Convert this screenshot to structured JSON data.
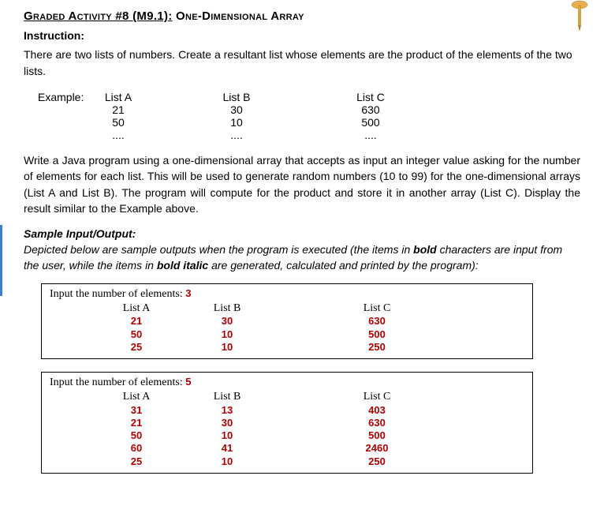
{
  "title": {
    "prefix": "Graded Activity #8 (M9.1):",
    "rest": " One-Dimensional Array"
  },
  "instruction_label": "Instruction:",
  "instruction_text": "There are two lists of numbers. Create a resultant list whose elements are the product of the elements of the two lists.",
  "example": {
    "label": "Example:",
    "headers": {
      "a": "List A",
      "b": "List B",
      "c": "List C"
    },
    "rows": [
      {
        "a": "21",
        "b": "30",
        "c": "630"
      },
      {
        "a": "50",
        "b": "10",
        "c": "500"
      },
      {
        "a": "....",
        "b": "....",
        "c": "...."
      }
    ]
  },
  "body_text": "Write a Java program using a one-dimensional array that accepts as input an integer value asking for the number of elements for each list. This will be used to generate random numbers (10 to 99) for the one-dimensional arrays (List A and List B). The program will compute for the product and store it in another array (List C). Display the result similar to the Example above.",
  "sample_label": "Sample Input/Output:",
  "sample_desc": {
    "pre": "Depicted below are sample outputs when the program is executed (the items in ",
    "bold1": "bold",
    "mid": " characters are input from the user, while the items in ",
    "bold2": "bold italic",
    "post": " are generated, calculated and printed by the program):"
  },
  "outputs": [
    {
      "prompt": "Input the number of elements: ",
      "n": "3",
      "headers": {
        "a": "List A",
        "b": "List B",
        "c": "List C"
      },
      "rows": [
        {
          "a": "21",
          "b": "30",
          "c": "630"
        },
        {
          "a": "50",
          "b": "10",
          "c": "500"
        },
        {
          "a": "25",
          "b": "10",
          "c": "250"
        }
      ]
    },
    {
      "prompt": "Input the number of elements: ",
      "n": "5",
      "headers": {
        "a": "List A",
        "b": "List B",
        "c": "List C"
      },
      "rows": [
        {
          "a": "31",
          "b": "13",
          "c": "403"
        },
        {
          "a": "21",
          "b": "30",
          "c": "630"
        },
        {
          "a": "50",
          "b": "10",
          "c": "500"
        },
        {
          "a": "60",
          "b": "41",
          "c": "2460"
        },
        {
          "a": "25",
          "b": "10",
          "c": "250"
        }
      ]
    }
  ]
}
